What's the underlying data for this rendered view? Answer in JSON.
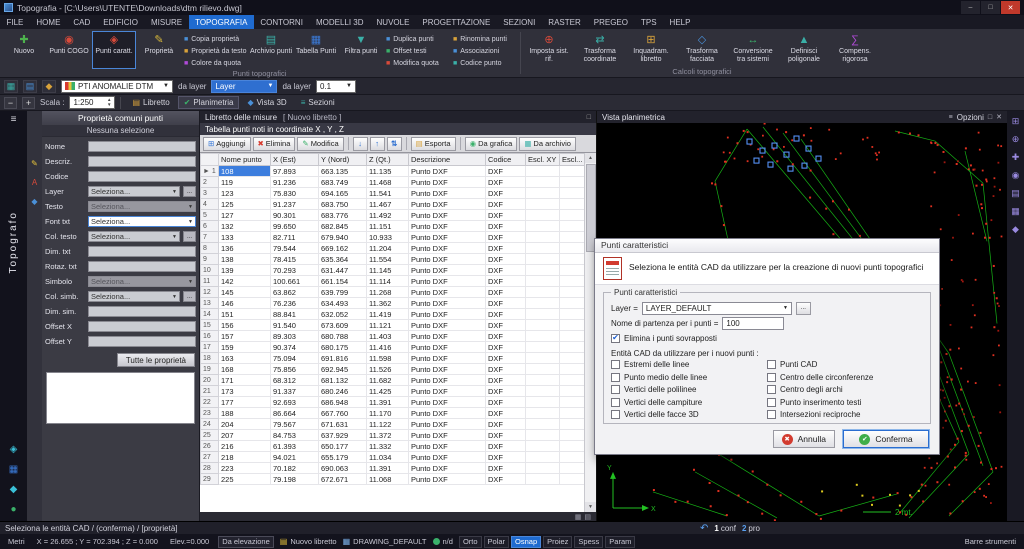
{
  "titlebar": {
    "title": "Topografia - [C:\\Users\\UTENTE\\Downloads\\dtm rilievo.dwg]"
  },
  "menubar": {
    "items": [
      "FILE",
      "HOME",
      "CAD",
      "EDIFICIO",
      "MISURE",
      "TOPOGRAFIA",
      "CONTORNI",
      "MODELLI 3D",
      "NUVOLE",
      "PROGETTAZIONE",
      "SEZIONI",
      "RASTER",
      "PREGEO",
      "TPS",
      "HELP"
    ],
    "active": "TOPOGRAFIA"
  },
  "ribbon": {
    "groups": [
      {
        "label": "Punti topografici",
        "items": [
          {
            "type": "big",
            "label": "Nuovo",
            "icon": "new-point-icon",
            "glyph": "✚",
            "color": "#4db24d"
          },
          {
            "type": "big",
            "label": "Punti COGO",
            "icon": "cogo-points-icon",
            "glyph": "◉",
            "color": "#d84a3a"
          },
          {
            "type": "big",
            "label": "Punti caratt.",
            "icon": "feature-points-icon",
            "glyph": "◈",
            "color": "#d84a3a",
            "active": true
          },
          {
            "type": "big",
            "label": "Proprietà",
            "icon": "properties-icon",
            "glyph": "✎",
            "color": "#d8b83a"
          },
          {
            "type": "stack",
            "items": [
              {
                "label": "Copia proprietà",
                "icon": "copy-properties-icon",
                "glyph": "■",
                "color": "#4a90d8"
              },
              {
                "label": "Proprietà da testo",
                "icon": "properties-from-text-icon",
                "glyph": "■",
                "color": "#d8a23a"
              },
              {
                "label": "Colore da quota",
                "icon": "color-from-elevation-icon",
                "glyph": "■",
                "color": "#b04ad8"
              }
            ]
          },
          {
            "type": "big",
            "label": "Archivio punti",
            "icon": "points-archive-icon",
            "glyph": "▤",
            "color": "#3ab0a8"
          },
          {
            "type": "big",
            "label": "Tabella Punti",
            "icon": "points-table-icon",
            "glyph": "▦",
            "color": "#3a7ad8"
          },
          {
            "type": "big",
            "label": "Filtra punti",
            "icon": "filter-points-icon",
            "glyph": "▼",
            "color": "#3ab0a8"
          },
          {
            "type": "stack",
            "items": [
              {
                "label": "Duplica punti",
                "icon": "duplicate-points-icon",
                "glyph": "■",
                "color": "#4a90d8"
              },
              {
                "label": "Offset testi",
                "icon": "offset-texts-icon",
                "glyph": "■",
                "color": "#3ab06a"
              },
              {
                "label": "Modifica quota",
                "icon": "edit-elevation-icon",
                "glyph": "■",
                "color": "#d84a3a"
              }
            ]
          },
          {
            "type": "stack",
            "items": [
              {
                "label": "Rinomina punti",
                "icon": "rename-points-icon",
                "glyph": "■",
                "color": "#d8a23a"
              },
              {
                "label": "Associazioni",
                "icon": "associations-icon",
                "glyph": "■",
                "color": "#4a90d8"
              },
              {
                "label": "Codice punto",
                "icon": "point-code-icon",
                "glyph": "■",
                "color": "#3ab0a8"
              }
            ]
          }
        ]
      },
      {
        "label": "Calcoli topografici",
        "items": [
          {
            "type": "big",
            "label": "Imposta sist. rif.",
            "icon": "reference-system-icon",
            "glyph": "⊕",
            "color": "#d84a3a"
          },
          {
            "type": "big",
            "label": "Trasforma coordinate",
            "icon": "transform-coordinates-icon",
            "glyph": "⇄",
            "color": "#3ab0a8"
          },
          {
            "type": "big",
            "label": "Inquadram. libretto",
            "icon": "frame-fieldbook-icon",
            "glyph": "⊞",
            "color": "#d8a23a"
          },
          {
            "type": "big",
            "label": "Trasforma facciata",
            "icon": "transform-facade-icon",
            "glyph": "◇",
            "color": "#4a90d8"
          },
          {
            "type": "big",
            "label": "Conversione tra sistemi",
            "icon": "convert-systems-icon",
            "glyph": "↔",
            "color": "#3ab06a"
          },
          {
            "type": "big",
            "label": "Definisci poligonale",
            "icon": "define-traverse-icon",
            "glyph": "▲",
            "color": "#3ab0a8"
          },
          {
            "type": "big",
            "label": "Compens. rigorosa",
            "icon": "rigorous-adjustment-icon",
            "glyph": "∑",
            "color": "#b04ad8"
          }
        ]
      }
    ]
  },
  "toolbar2": {
    "combo_points": "PTI ANOMALIE DTM",
    "from_layer_label": "da layer",
    "layer_combo": "Layer",
    "from_layer2_label": "da layer",
    "height_combo": "0.1"
  },
  "toolbar3": {
    "scale_label": "Scala :",
    "scale_value": "1:250",
    "tabs": [
      {
        "label": "Libretto",
        "icon": "fieldbook-tab-icon",
        "glyph": "▤",
        "color": "#d8a23a"
      },
      {
        "label": "Planimetria",
        "icon": "planimetry-tab-icon",
        "glyph": "✔",
        "color": "#3ab06a",
        "active": true
      },
      {
        "label": "Vista 3D",
        "icon": "view-3d-tab-icon",
        "glyph": "◆",
        "color": "#4a90d8"
      },
      {
        "label": "Sezioni",
        "icon": "sections-tab-icon",
        "glyph": "≡",
        "color": "#3ab0a8"
      }
    ]
  },
  "left_strip": {
    "app_name": "Topografo",
    "menu_glyph": "≡",
    "tools": [
      {
        "name": "measure-tool-icon",
        "glyph": "◈",
        "color": "#3ac0d8"
      },
      {
        "name": "layers-tool-icon",
        "glyph": "▦",
        "color": "#3a7ad8"
      },
      {
        "name": "snap-tool-icon",
        "glyph": "◆",
        "color": "#3ac0d8"
      },
      {
        "name": "settings-tool-icon",
        "glyph": "●",
        "color": "#3ab06a"
      }
    ]
  },
  "left_panel": {
    "title": "Proprietà comuni punti",
    "subtitle": "Nessuna selezione",
    "side_tools": [
      {
        "name": "edit-properties-icon",
        "glyph": "✎",
        "color": "#e8c43a"
      },
      {
        "name": "text-properties-icon",
        "glyph": "A",
        "color": "#d84a3a"
      },
      {
        "name": "symbol-properties-icon",
        "glyph": "◆",
        "color": "#4a90d8"
      }
    ],
    "fields": [
      {
        "label": "Nome",
        "type": "input",
        "value": ""
      },
      {
        "label": "Descriz.",
        "type": "input",
        "value": ""
      },
      {
        "label": "Codice",
        "type": "input",
        "value": ""
      },
      {
        "label": "Layer",
        "type": "combo",
        "value": "Seleziona...",
        "browse": true
      },
      {
        "label": "Testo",
        "type": "combo-disabled",
        "value": "Seleziona..."
      },
      {
        "label": "Font txt",
        "type": "combo-active",
        "value": "Seleziona..."
      },
      {
        "label": "Col. testo",
        "type": "combo",
        "value": "Seleziona...",
        "browse": true
      },
      {
        "label": "Dim. txt",
        "type": "input",
        "value": ""
      },
      {
        "label": "Rotaz. txt",
        "type": "input",
        "value": ""
      },
      {
        "label": "Simbolo",
        "type": "combo-disabled",
        "value": "Seleziona..."
      },
      {
        "label": "Col. simb.",
        "type": "combo",
        "value": "Seleziona...",
        "browse": true
      },
      {
        "label": "Dim. sim.",
        "type": "input",
        "value": ""
      },
      {
        "label": "Offset X",
        "type": "input",
        "value": ""
      },
      {
        "label": "Offset Y",
        "type": "input",
        "value": ""
      }
    ],
    "all_props_button": "Tutte le proprietà"
  },
  "center": {
    "tab_title": "Libretto delle misure",
    "tab_extra": "[ Nuovo libretto ]",
    "section_title": "Tabella punti noti in coordinate X , Y , Z",
    "buttons": [
      {
        "label": "Aggiungi",
        "icon": "add-row-icon",
        "glyph": "⊞",
        "color": "#3a7ad8"
      },
      {
        "label": "Elimina",
        "icon": "delete-row-icon",
        "glyph": "✖",
        "color": "#d83a2e"
      },
      {
        "label": "Modifica",
        "icon": "edit-row-icon",
        "glyph": "✎",
        "color": "#3ab06a"
      }
    ],
    "icon_buttons": [
      {
        "name": "sort-ascending-icon",
        "glyph": "↓"
      },
      {
        "name": "sort-descending-icon",
        "glyph": "↑"
      },
      {
        "name": "sort-numeric-icon",
        "glyph": "⇅"
      }
    ],
    "buttons2": [
      {
        "label": "Esporta",
        "icon": "export-icon",
        "glyph": "▤",
        "color": "#d8a23a"
      },
      {
        "label": "Da grafica",
        "icon": "from-graphics-icon",
        "glyph": "◉",
        "color": "#3ab06a"
      },
      {
        "label": "Da archivio",
        "icon": "from-archive-icon",
        "glyph": "▦",
        "color": "#3ab0a8"
      }
    ],
    "columns": [
      "Nome punto",
      "X (Est)",
      "Y (Nord)",
      "Z (Qt.)",
      "Descrizione",
      "Codice",
      "Escl. XY",
      "Escl..."
    ],
    "selected_row": 0,
    "rows": [
      [
        "108",
        "97.893",
        "663.135",
        "11.135",
        "Punto DXF",
        "DXF"
      ],
      [
        "119",
        "91.236",
        "683.749",
        "11.468",
        "Punto DXF",
        "DXF"
      ],
      [
        "123",
        "75.830",
        "694.165",
        "11.541",
        "Punto DXF",
        "DXF"
      ],
      [
        "125",
        "91.237",
        "683.750",
        "11.467",
        "Punto DXF",
        "DXF"
      ],
      [
        "127",
        "90.301",
        "683.776",
        "11.492",
        "Punto DXF",
        "DXF"
      ],
      [
        "132",
        "99.650",
        "682.845",
        "11.151",
        "Punto DXF",
        "DXF"
      ],
      [
        "133",
        "82.711",
        "679.940",
        "10.933",
        "Punto DXF",
        "DXF"
      ],
      [
        "136",
        "79.544",
        "669.162",
        "11.204",
        "Punto DXF",
        "DXF"
      ],
      [
        "138",
        "78.415",
        "635.364",
        "11.554",
        "Punto DXF",
        "DXF"
      ],
      [
        "139",
        "70.293",
        "631.447",
        "11.145",
        "Punto DXF",
        "DXF"
      ],
      [
        "142",
        "100.661",
        "661.154",
        "11.114",
        "Punto DXF",
        "DXF"
      ],
      [
        "145",
        "63.862",
        "639.799",
        "11.268",
        "Punto DXF",
        "DXF"
      ],
      [
        "146",
        "76.236",
        "634.493",
        "11.362",
        "Punto DXF",
        "DXF"
      ],
      [
        "151",
        "88.841",
        "632.052",
        "11.419",
        "Punto DXF",
        "DXF"
      ],
      [
        "156",
        "91.540",
        "673.609",
        "11.121",
        "Punto DXF",
        "DXF"
      ],
      [
        "157",
        "89.303",
        "680.788",
        "11.403",
        "Punto DXF",
        "DXF"
      ],
      [
        "159",
        "90.374",
        "680.175",
        "11.416",
        "Punto DXF",
        "DXF"
      ],
      [
        "163",
        "75.094",
        "691.816",
        "11.598",
        "Punto DXF",
        "DXF"
      ],
      [
        "168",
        "75.856",
        "692.945",
        "11.526",
        "Punto DXF",
        "DXF"
      ],
      [
        "171",
        "68.312",
        "681.132",
        "11.682",
        "Punto DXF",
        "DXF"
      ],
      [
        "173",
        "91.337",
        "680.246",
        "11.425",
        "Punto DXF",
        "DXF"
      ],
      [
        "177",
        "92.693",
        "686.948",
        "11.391",
        "Punto DXF",
        "DXF"
      ],
      [
        "188",
        "86.664",
        "667.760",
        "11.170",
        "Punto DXF",
        "DXF"
      ],
      [
        "204",
        "79.567",
        "671.631",
        "11.122",
        "Punto DXF",
        "DXF"
      ],
      [
        "207",
        "84.753",
        "637.929",
        "11.372",
        "Punto DXF",
        "DXF"
      ],
      [
        "216",
        "61.393",
        "650.177",
        "11.332",
        "Punto DXF",
        "DXF"
      ],
      [
        "218",
        "94.021",
        "655.179",
        "11.034",
        "Punto DXF",
        "DXF"
      ],
      [
        "223",
        "70.182",
        "690.063",
        "11.391",
        "Punto DXF",
        "DXF"
      ],
      [
        "225",
        "79.198",
        "672.671",
        "11.068",
        "Punto DXF",
        "DXF"
      ]
    ]
  },
  "right_panel": {
    "title": "Vista planimetrica",
    "options_label": "Opzioni",
    "axis_x_label": "X",
    "axis_y_label": "Y",
    "scale_note": "2 mt."
  },
  "right_strip": {
    "tools": [
      {
        "name": "zoom-window-icon",
        "glyph": "⊞"
      },
      {
        "name": "zoom-extents-icon",
        "glyph": "⊕"
      },
      {
        "name": "pan-icon",
        "glyph": "✚"
      },
      {
        "name": "orbit-icon",
        "glyph": "◉"
      },
      {
        "name": "measure-icon",
        "glyph": "▤"
      },
      {
        "name": "layers-view-icon",
        "glyph": "▦"
      },
      {
        "name": "grid-toggle-icon",
        "glyph": "◆"
      }
    ]
  },
  "dialog": {
    "title": "Punti caratteristici",
    "description": "Seleziona le entità CAD da utilizzare per la creazione di nuovi punti topografici",
    "group_label": "Punti caratteristici",
    "layer_label": "Layer =",
    "layer_value": "LAYER_DEFAULT",
    "browse": "...",
    "start_name_label": "Nome di partenza per i punti =",
    "start_name_value": "100",
    "remove_overlap_label": "Elimina i punti sovrapposti",
    "remove_overlap_checked": true,
    "entities_label": "Entità CAD da utilizzare per i nuovi punti :",
    "checkboxes_left": [
      "Estremi delle linee",
      "Punto medio delle linee",
      "Vertici delle polilinee",
      "Vertici delle campiture",
      "Vertici delle facce 3D"
    ],
    "checkboxes_right": [
      "Punti CAD",
      "Centro delle circonferenze",
      "Centro degli archi",
      "Punto inserimento testi",
      "Intersezioni reciproche"
    ],
    "cancel": "Annulla",
    "confirm": "Conferma"
  },
  "statusbar": {
    "message": "Seleziona le entità CAD / (conferma) / [proprietà]",
    "options": [
      {
        "num": "1",
        "label": "conf"
      },
      {
        "num": "2",
        "label": "pro"
      }
    ]
  },
  "bottombar": {
    "unit": "Metri",
    "coords": "X = 26.655 ; Y = 702.394 ; Z = 0.000",
    "elevation": "Elev.=0.000",
    "da_elevazione": "Da elevazione",
    "libretto": "Nuovo libretto",
    "drawing_layer": "DRAWING_DEFAULT",
    "nd": "n/d",
    "toggles": [
      "Orto",
      "Polar",
      "Osnap",
      "Proiez",
      "Spess",
      "Param"
    ],
    "active_toggle": "Osnap",
    "toolbars_label": "Barre strumenti"
  }
}
